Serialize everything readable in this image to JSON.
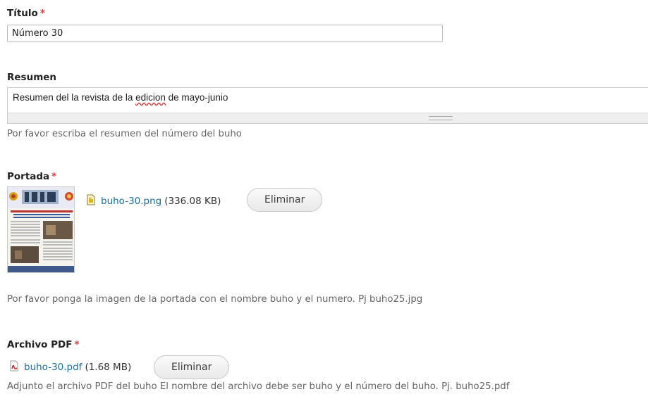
{
  "titulo": {
    "label": "Título",
    "required_marker": "*",
    "value": "Número 30"
  },
  "resumen": {
    "label": "Resumen",
    "value_before": "Resumen del la revista de la ",
    "value_misspelled": "edicion",
    "value_after": " de mayo-junio",
    "description": "Por favor escriba el resumen del número del buho"
  },
  "portada": {
    "label": "Portada",
    "required_marker": "*",
    "file_name": "buho-30.png",
    "file_size": "(336.08 KB)",
    "file_icon": "image-file-icon",
    "remove_label": "Eliminar",
    "description": "Por favor ponga la imagen de la portada con el nombre buho y el numero. Pj buho25.jpg"
  },
  "archivo_pdf": {
    "label": "Archivo PDF",
    "required_marker": "*",
    "file_name": "buho-30.pdf",
    "file_size": "(1.68 MB)",
    "file_icon": "pdf-file-icon",
    "remove_label": "Eliminar",
    "description": "Adjunto el archivo PDF del buho El nombre del archivo debe ser buho y el número del buho. Pj. buho25.pdf"
  },
  "colors": {
    "link": "#1a6fa8",
    "required": "#e0403a",
    "description_text": "#666666"
  }
}
